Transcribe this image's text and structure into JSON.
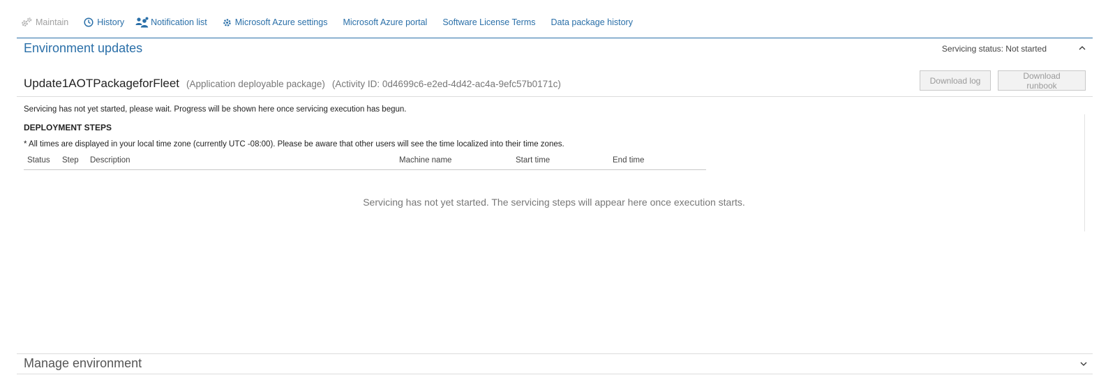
{
  "toolbar": {
    "items": [
      {
        "label": "Maintain",
        "icon": "gears-icon",
        "disabled": true
      },
      {
        "label": "History",
        "icon": "clock-icon"
      },
      {
        "label": "Notification list",
        "icon": "people-icon"
      },
      {
        "label": "Microsoft Azure settings",
        "icon": "gear-icon"
      },
      {
        "label": "Microsoft Azure portal"
      },
      {
        "label": "Software License Terms"
      },
      {
        "label": "Data package history"
      }
    ]
  },
  "environment_updates": {
    "title": "Environment updates",
    "servicing_status": "Servicing status: Not started",
    "package_name": "Update1AOTPackageforFleet",
    "package_type": "(Application deployable package)",
    "activity_id": "(Activity ID: 0d4699c6-e2ed-4d42-ac4a-9efc57b0171c)",
    "download_log_label": "Download log",
    "download_runbook_label": "Download runbook",
    "message": "Servicing has not yet started, please wait. Progress will be shown here once servicing execution has begun.",
    "steps_heading": "DEPLOYMENT STEPS",
    "timezone_note": "* All times are displayed in your local time zone (currently UTC -08:00). Please be aware that other users will see the time localized into their time zones.",
    "columns": [
      "Status",
      "Step",
      "Description",
      "Machine name",
      "Start time",
      "End time"
    ],
    "empty_message": "Servicing has not yet started. The servicing steps will appear here once execution starts."
  },
  "manage_environment": {
    "title": "Manage environment"
  },
  "colors": {
    "accent": "#2a6fa8",
    "disabled_text": "#a0a0a0",
    "muted_text": "#777777"
  }
}
